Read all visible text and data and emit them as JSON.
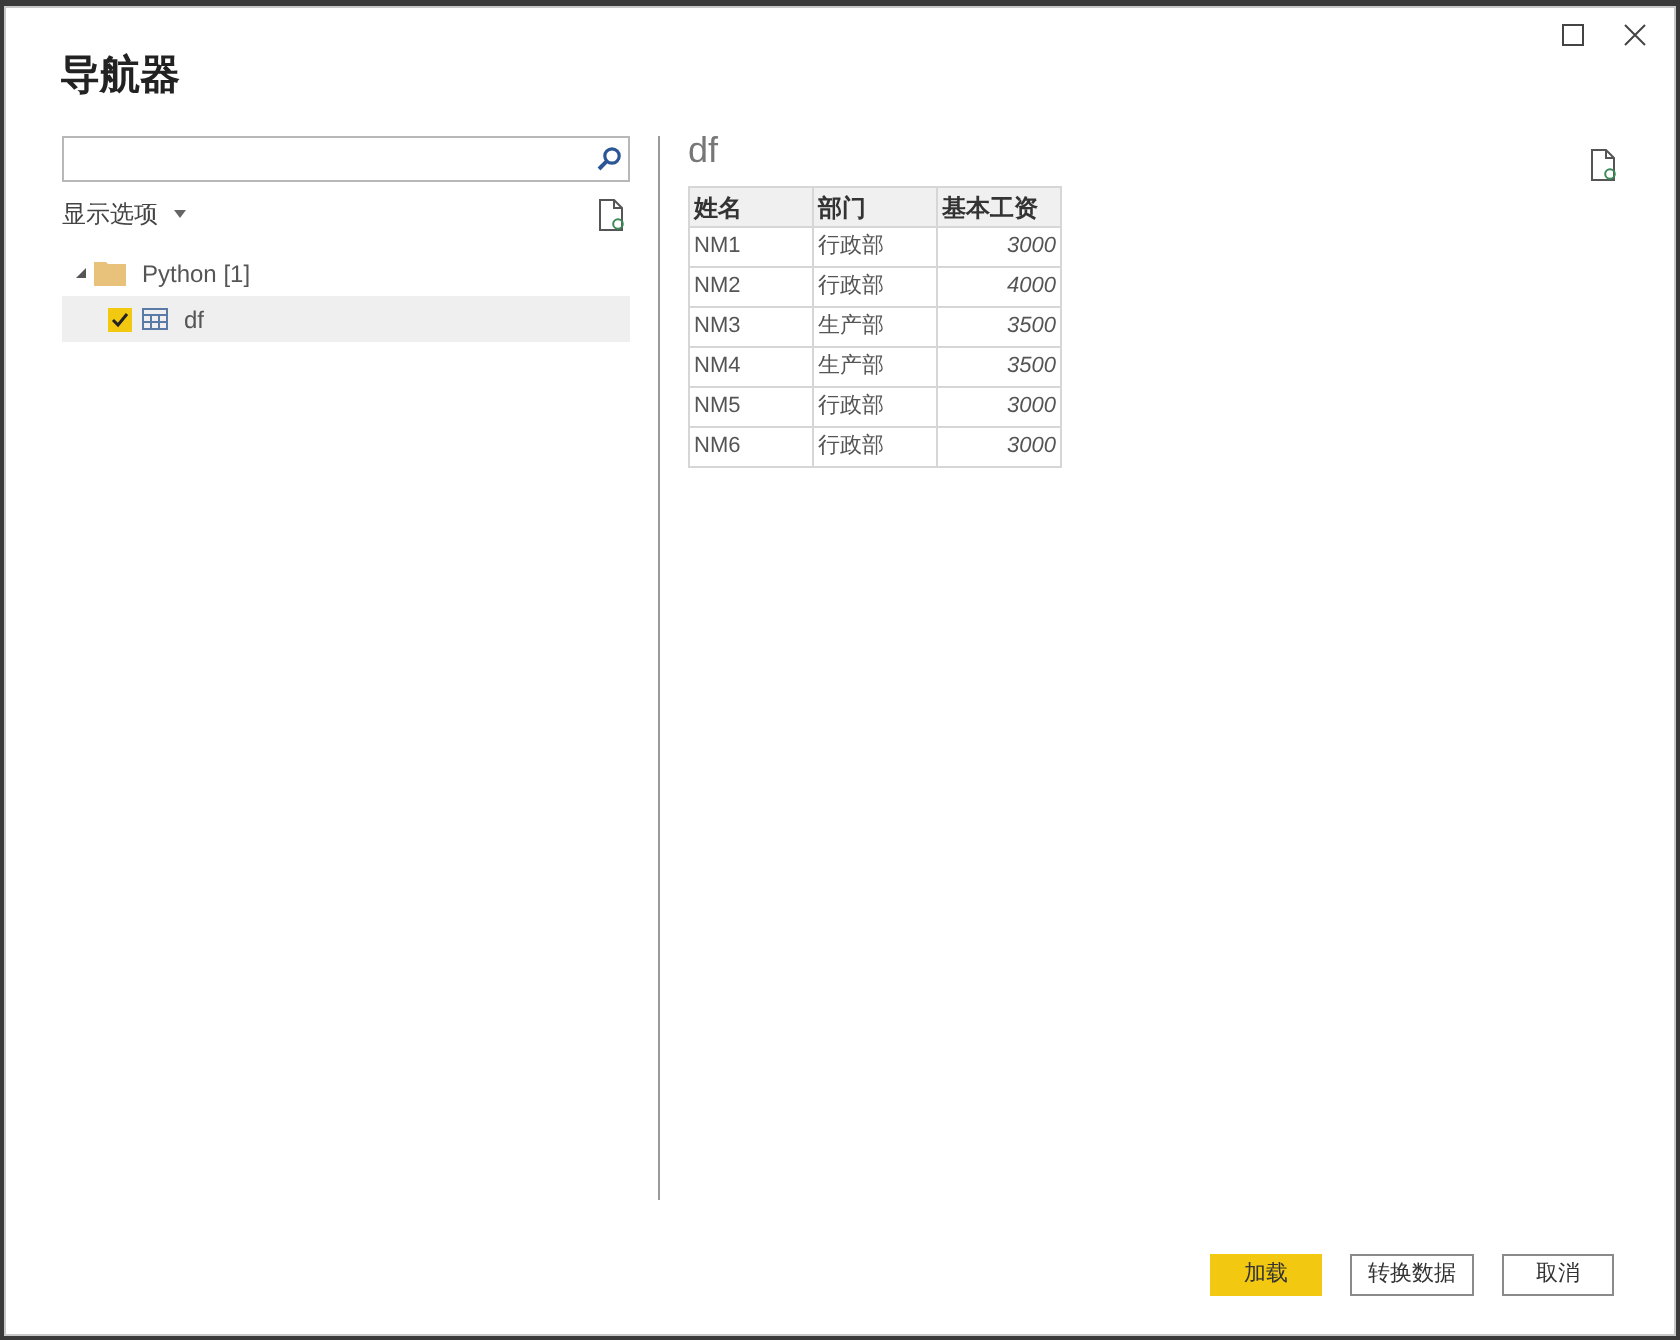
{
  "window": {
    "title": "导航器"
  },
  "navigator": {
    "display_options": "显示选项",
    "tree": [
      {
        "label": "Python [1]",
        "kind": "folder",
        "expanded": true,
        "children": [
          {
            "label": "df",
            "kind": "table",
            "checked": true,
            "selected": true
          }
        ]
      }
    ]
  },
  "preview": {
    "title": "df",
    "table": {
      "columns": [
        "姓名",
        "部门",
        "基本工资"
      ],
      "rows": [
        [
          "NM1",
          "行政部",
          "3000"
        ],
        [
          "NM2",
          "行政部",
          "4000"
        ],
        [
          "NM3",
          "生产部",
          "3500"
        ],
        [
          "NM4",
          "生产部",
          "3500"
        ],
        [
          "NM5",
          "行政部",
          "3000"
        ],
        [
          "NM6",
          "行政部",
          "3000"
        ]
      ]
    }
  },
  "buttons": [
    {
      "label": "加载",
      "kind": "primary"
    },
    {
      "label": "转换数据",
      "kind": "secondary"
    },
    {
      "label": "取消",
      "kind": "secondary"
    }
  ]
}
